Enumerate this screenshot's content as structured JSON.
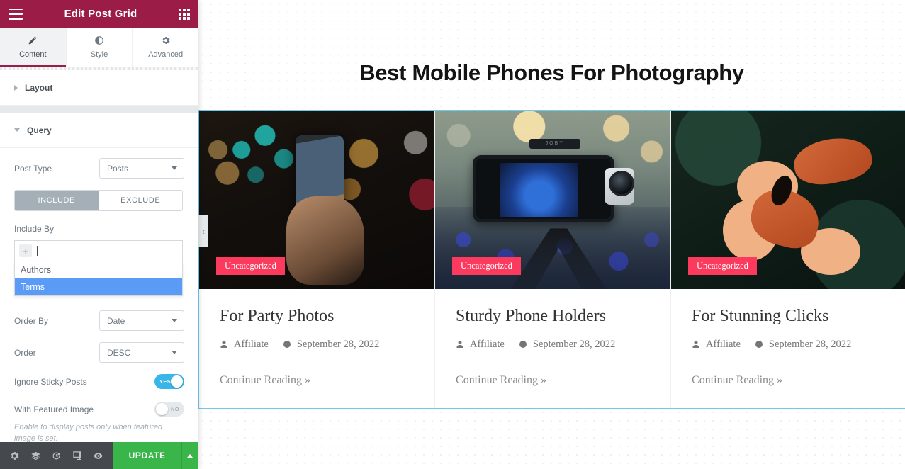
{
  "panel": {
    "header": {
      "title": "Edit Post Grid",
      "menu_icon": "hamburger-icon",
      "apps_icon": "grid-apps-icon"
    },
    "tabs": [
      {
        "id": "content",
        "label": "Content",
        "icon": "pencil-icon",
        "active": true
      },
      {
        "id": "style",
        "label": "Style",
        "icon": "contrast-circle-icon",
        "active": false
      },
      {
        "id": "advanced",
        "label": "Advanced",
        "icon": "gear-icon",
        "active": false
      }
    ],
    "sections": [
      {
        "id": "layout",
        "label": "Layout",
        "expanded": false
      },
      {
        "id": "query",
        "label": "Query",
        "expanded": true
      }
    ],
    "query": {
      "post_type": {
        "label": "Post Type",
        "value": "Posts"
      },
      "include_exclude": {
        "options": [
          "INCLUDE",
          "EXCLUDE"
        ],
        "selected": "INCLUDE"
      },
      "include_by": {
        "label": "Include By",
        "input_value": "",
        "add_icon": "plus-icon",
        "dropdown_open": true,
        "options": [
          "Authors",
          "Terms"
        ],
        "highlighted": "Terms"
      },
      "order_by": {
        "label": "Order By",
        "value": "Date"
      },
      "order": {
        "label": "Order",
        "value": "DESC"
      },
      "ignore_sticky": {
        "label": "Ignore Sticky Posts",
        "state": "YES",
        "on": true
      },
      "with_featured": {
        "label": "With Featured Image",
        "state": "NO",
        "on": false
      },
      "featured_help": "Enable to display posts only when featured image is set."
    },
    "collapse_handle": {
      "icon": "chevron-left-icon",
      "glyph": "‹"
    },
    "footer": {
      "icons": [
        {
          "name": "settings-gear-icon"
        },
        {
          "name": "navigator-layers-icon"
        },
        {
          "name": "history-clock-icon"
        },
        {
          "name": "responsive-mode-icon"
        },
        {
          "name": "preview-eye-icon"
        }
      ],
      "update_label": "UPDATE",
      "update_caret_icon": "caret-up-icon"
    }
  },
  "canvas": {
    "heading": "Best Mobile Phones For Photography",
    "posts": [
      {
        "badge": "Uncategorized",
        "title": "For Party Photos",
        "author": "Affiliate",
        "date": "September 28, 2022",
        "read_more": "Continue Reading »",
        "image_alt": "hand-holding-phone-bokeh-lights-photo",
        "author_icon": "user-icon",
        "date_icon": "clock-icon"
      },
      {
        "badge": "Uncategorized",
        "title": "Sturdy Phone Holders",
        "author": "Affiliate",
        "date": "September 28, 2022",
        "read_more": "Continue Reading »",
        "image_alt": "phone-on-joby-tripod-blue-flowers-photo",
        "author_icon": "user-icon",
        "date_icon": "clock-icon"
      },
      {
        "badge": "Uncategorized",
        "title": "For Stunning Clicks",
        "author": "Affiliate",
        "date": "September 28, 2022",
        "read_more": "Continue Reading »",
        "image_alt": "orange-butterfly-on-flower-photo",
        "author_icon": "user-icon",
        "date_icon": "clock-icon"
      }
    ]
  },
  "colors": {
    "panel_header": "#9b1d47",
    "accent_tab": "#9b1d47",
    "update_green": "#39b54a",
    "toggle_on": "#39b6e8",
    "dropdown_highlight": "#5a9bf6",
    "badge_pink": "#fb3a5d",
    "selection_blue": "#6ec9ef"
  }
}
